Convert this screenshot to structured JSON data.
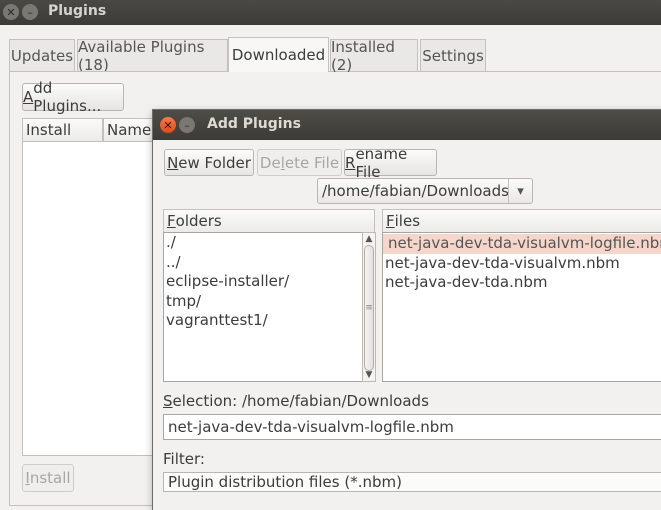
{
  "main_window": {
    "title": "Plugins",
    "close_glyph": "✕",
    "minimize_glyph": "–",
    "tabs": [
      {
        "label": "Updates"
      },
      {
        "label": "Available Plugins (18)"
      },
      {
        "label": "Downloaded"
      },
      {
        "label": "Installed (2)"
      },
      {
        "label": "Settings"
      }
    ],
    "add_plugins_first": "A",
    "add_plugins_rest": "dd Plugins...",
    "columns": {
      "install": "Install",
      "name": "Name"
    },
    "install_first": "I",
    "install_rest": "nstall"
  },
  "dialog": {
    "title": "Add Plugins",
    "close_glyph": "✕",
    "minimize_glyph": "–",
    "new_folder_first": "N",
    "new_folder_rest": "ew Folder",
    "delete_file_pre": "De",
    "delete_file_mnem": "l",
    "delete_file_post": "ete File",
    "rename_file_first": "R",
    "rename_file_rest": "ename File",
    "path_combo": "/home/fabian/Downloads",
    "combo_arrow": "▾",
    "folders_header_first": "F",
    "folders_header_rest": "olders",
    "files_header_first": "F",
    "files_header_rest": "iles",
    "folders": [
      "./",
      "../",
      "eclipse-installer/",
      "tmp/",
      "vagranttest1/"
    ],
    "files": [
      "net-java-dev-tda-visualvm-logfile.nbm",
      "net-java-dev-tda-visualvm.nbm",
      "net-java-dev-tda.nbm"
    ],
    "selection_label_first": "S",
    "selection_label_rest": "election: /home/fabian/Downloads",
    "selection_value": "net-java-dev-tda-visualvm-logfile.nbm",
    "filter_label": "Filter:",
    "filter_value": "Plugin distribution files (*.nbm)",
    "scroll_up": "▲",
    "scroll_down": "▼",
    "grip": "≡"
  },
  "colors": {
    "titlebar": "#3c3b37",
    "close_button": "#e95420",
    "selection_highlight": "#f6d6cb"
  }
}
